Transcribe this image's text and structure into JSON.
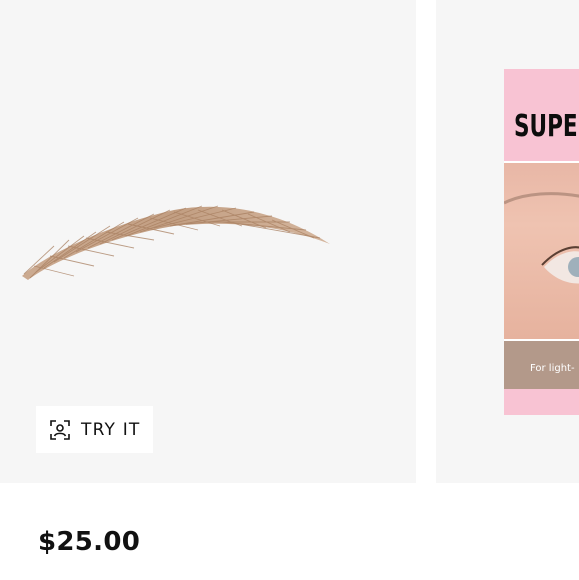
{
  "product": {
    "price": "$25.00",
    "try_it_label": "TRY IT"
  },
  "gallery": {
    "box": {
      "title": "SUPE",
      "band_text": "For light-"
    }
  },
  "icons": {
    "try_it": "face-scan-icon"
  },
  "colors": {
    "card_background": "#f6f6f6",
    "brow_color": "#c29a79",
    "box_pink": "#f8c3d3",
    "box_band": "#b3998a"
  }
}
